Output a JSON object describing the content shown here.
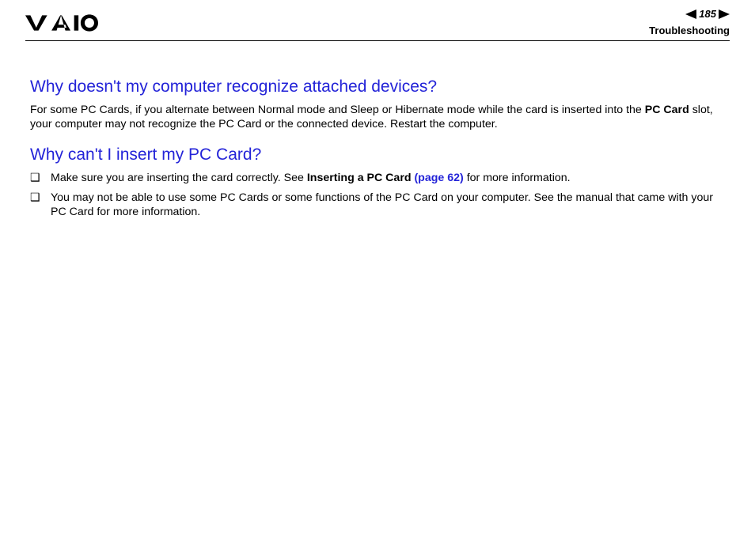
{
  "header": {
    "page_number": "185",
    "section": "Troubleshooting"
  },
  "sections": [
    {
      "heading": "Why doesn't my computer recognize attached devices?",
      "paragraph_parts": {
        "pre": "For some PC Cards, if you alternate between Normal mode and Sleep or Hibernate mode while the card is inserted into the ",
        "bold": "PC Card",
        "post": " slot, your computer may not recognize the PC Card or the connected device. Restart the computer."
      }
    },
    {
      "heading": "Why can't I insert my PC Card?",
      "bullets": [
        {
          "pre": "Make sure you are inserting the card correctly. See ",
          "bold": "Inserting a PC Card ",
          "link": "(page 62)",
          "post": " for more information."
        },
        {
          "text": "You may not be able to use some PC Cards or some functions of the PC Card on your computer. See the manual that came with your PC Card for more information."
        }
      ]
    }
  ]
}
